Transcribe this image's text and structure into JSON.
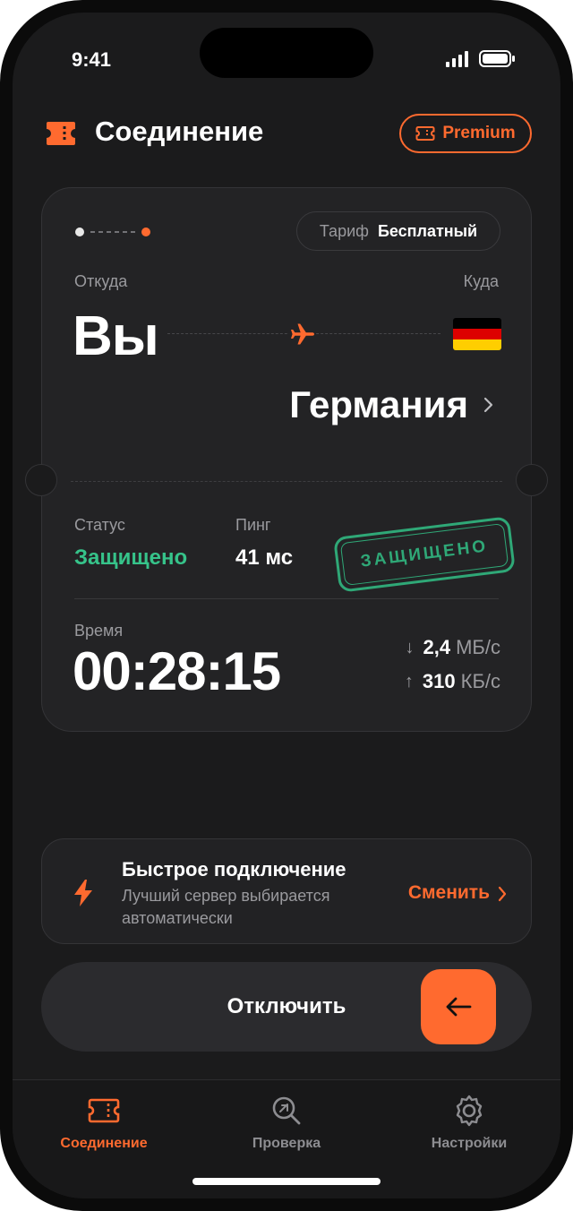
{
  "status_bar": {
    "time": "9:41"
  },
  "header": {
    "title": "Соединение",
    "premium_label": "Premium"
  },
  "ticket": {
    "tariff_key": "Тариф",
    "tariff_value": "Бесплатный",
    "from_label": "Откуда",
    "from_value": "Вы",
    "to_label": "Куда",
    "to_country": "Германия",
    "flag": [
      "#000000",
      "#dd0000",
      "#ffce00"
    ],
    "status_label": "Статус",
    "status_value": "Защищено",
    "ping_label": "Пинг",
    "ping_value": "41 мс",
    "stamp_text": "ЗАЩИЩЕНО",
    "time_label": "Время",
    "time_value": "00:28:15",
    "download": {
      "arrow": "↓",
      "value": "2,4",
      "unit": "МБ/с"
    },
    "upload": {
      "arrow": "↑",
      "value": "310",
      "unit": "КБ/с"
    }
  },
  "quick_connect": {
    "title": "Быстрое подключение",
    "subtitle": "Лучший сервер выбирается автоматически",
    "action": "Сменить"
  },
  "disconnect": {
    "label": "Отключить"
  },
  "tabs": [
    {
      "label": "Соединение",
      "icon": "ticket-icon",
      "active": true
    },
    {
      "label": "Проверка",
      "icon": "search-icon",
      "active": false
    },
    {
      "label": "Настройки",
      "icon": "gear-icon",
      "active": false
    }
  ],
  "colors": {
    "accent": "#ff6a2f",
    "success": "#36c38a",
    "background": "#1b1b1c",
    "card": "#232325"
  }
}
